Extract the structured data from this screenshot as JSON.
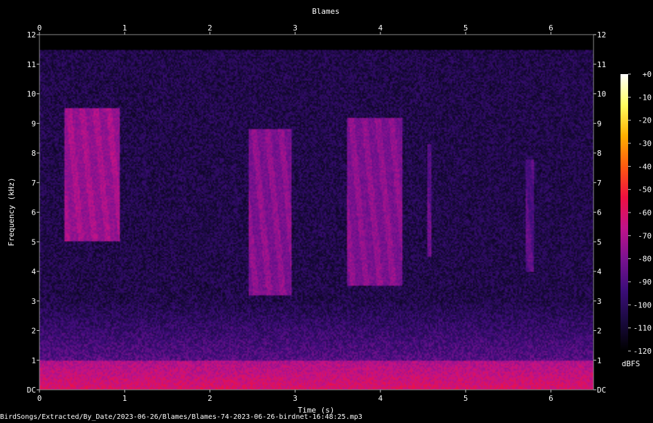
{
  "chart_data": {
    "type": "heatmap",
    "title": "Blames",
    "xlabel": "Time (s)",
    "ylabel": "Frequency (kHz)",
    "xlim": [
      0,
      6.5
    ],
    "ylim": [
      0,
      12
    ],
    "x_ticks": [
      "0",
      "1",
      "2",
      "3",
      "4",
      "5",
      "6"
    ],
    "y_ticks": [
      "DC",
      "1",
      "2",
      "3",
      "4",
      "5",
      "6",
      "7",
      "8",
      "9",
      "10",
      "11",
      "12"
    ],
    "colorbar": {
      "label": "dBFS",
      "range": [
        -120,
        0
      ],
      "ticks": [
        "+0",
        "-10",
        "-20",
        "-30",
        "-40",
        "-50",
        "-60",
        "-70",
        "-80",
        "-90",
        "-100",
        "-110",
        "-120"
      ],
      "colors": [
        "#000000",
        "#1a0a40",
        "#3d0d7a",
        "#7a1290",
        "#c0138a",
        "#f01040",
        "#ff5a10",
        "#ffb000",
        "#ffff60",
        "#ffffff"
      ]
    },
    "noise_floor_dbfs": -100,
    "signal_events": [
      {
        "t_start": 0.3,
        "t_end": 0.95,
        "f_low": 5.0,
        "f_high": 9.5,
        "level_dbfs": -70
      },
      {
        "t_start": 2.45,
        "t_end": 2.95,
        "f_low": 3.2,
        "f_high": 8.8,
        "level_dbfs": -75
      },
      {
        "t_start": 3.6,
        "t_end": 4.25,
        "f_low": 3.5,
        "f_high": 9.2,
        "level_dbfs": -75
      },
      {
        "t_start": 4.55,
        "t_end": 4.6,
        "f_low": 4.5,
        "f_high": 8.3,
        "level_dbfs": -82
      },
      {
        "t_start": 5.7,
        "t_end": 5.8,
        "f_low": 4.0,
        "f_high": 7.8,
        "level_dbfs": -85
      }
    ],
    "low_band": {
      "f_low": 0,
      "f_high": 1.0,
      "level_dbfs": -60
    }
  },
  "footer": {
    "path": "BirdSongs/Extracted/By_Date/2023-06-26/Blames/Blames-74-2023-06-26-birdnet-16:48:25.mp3"
  }
}
